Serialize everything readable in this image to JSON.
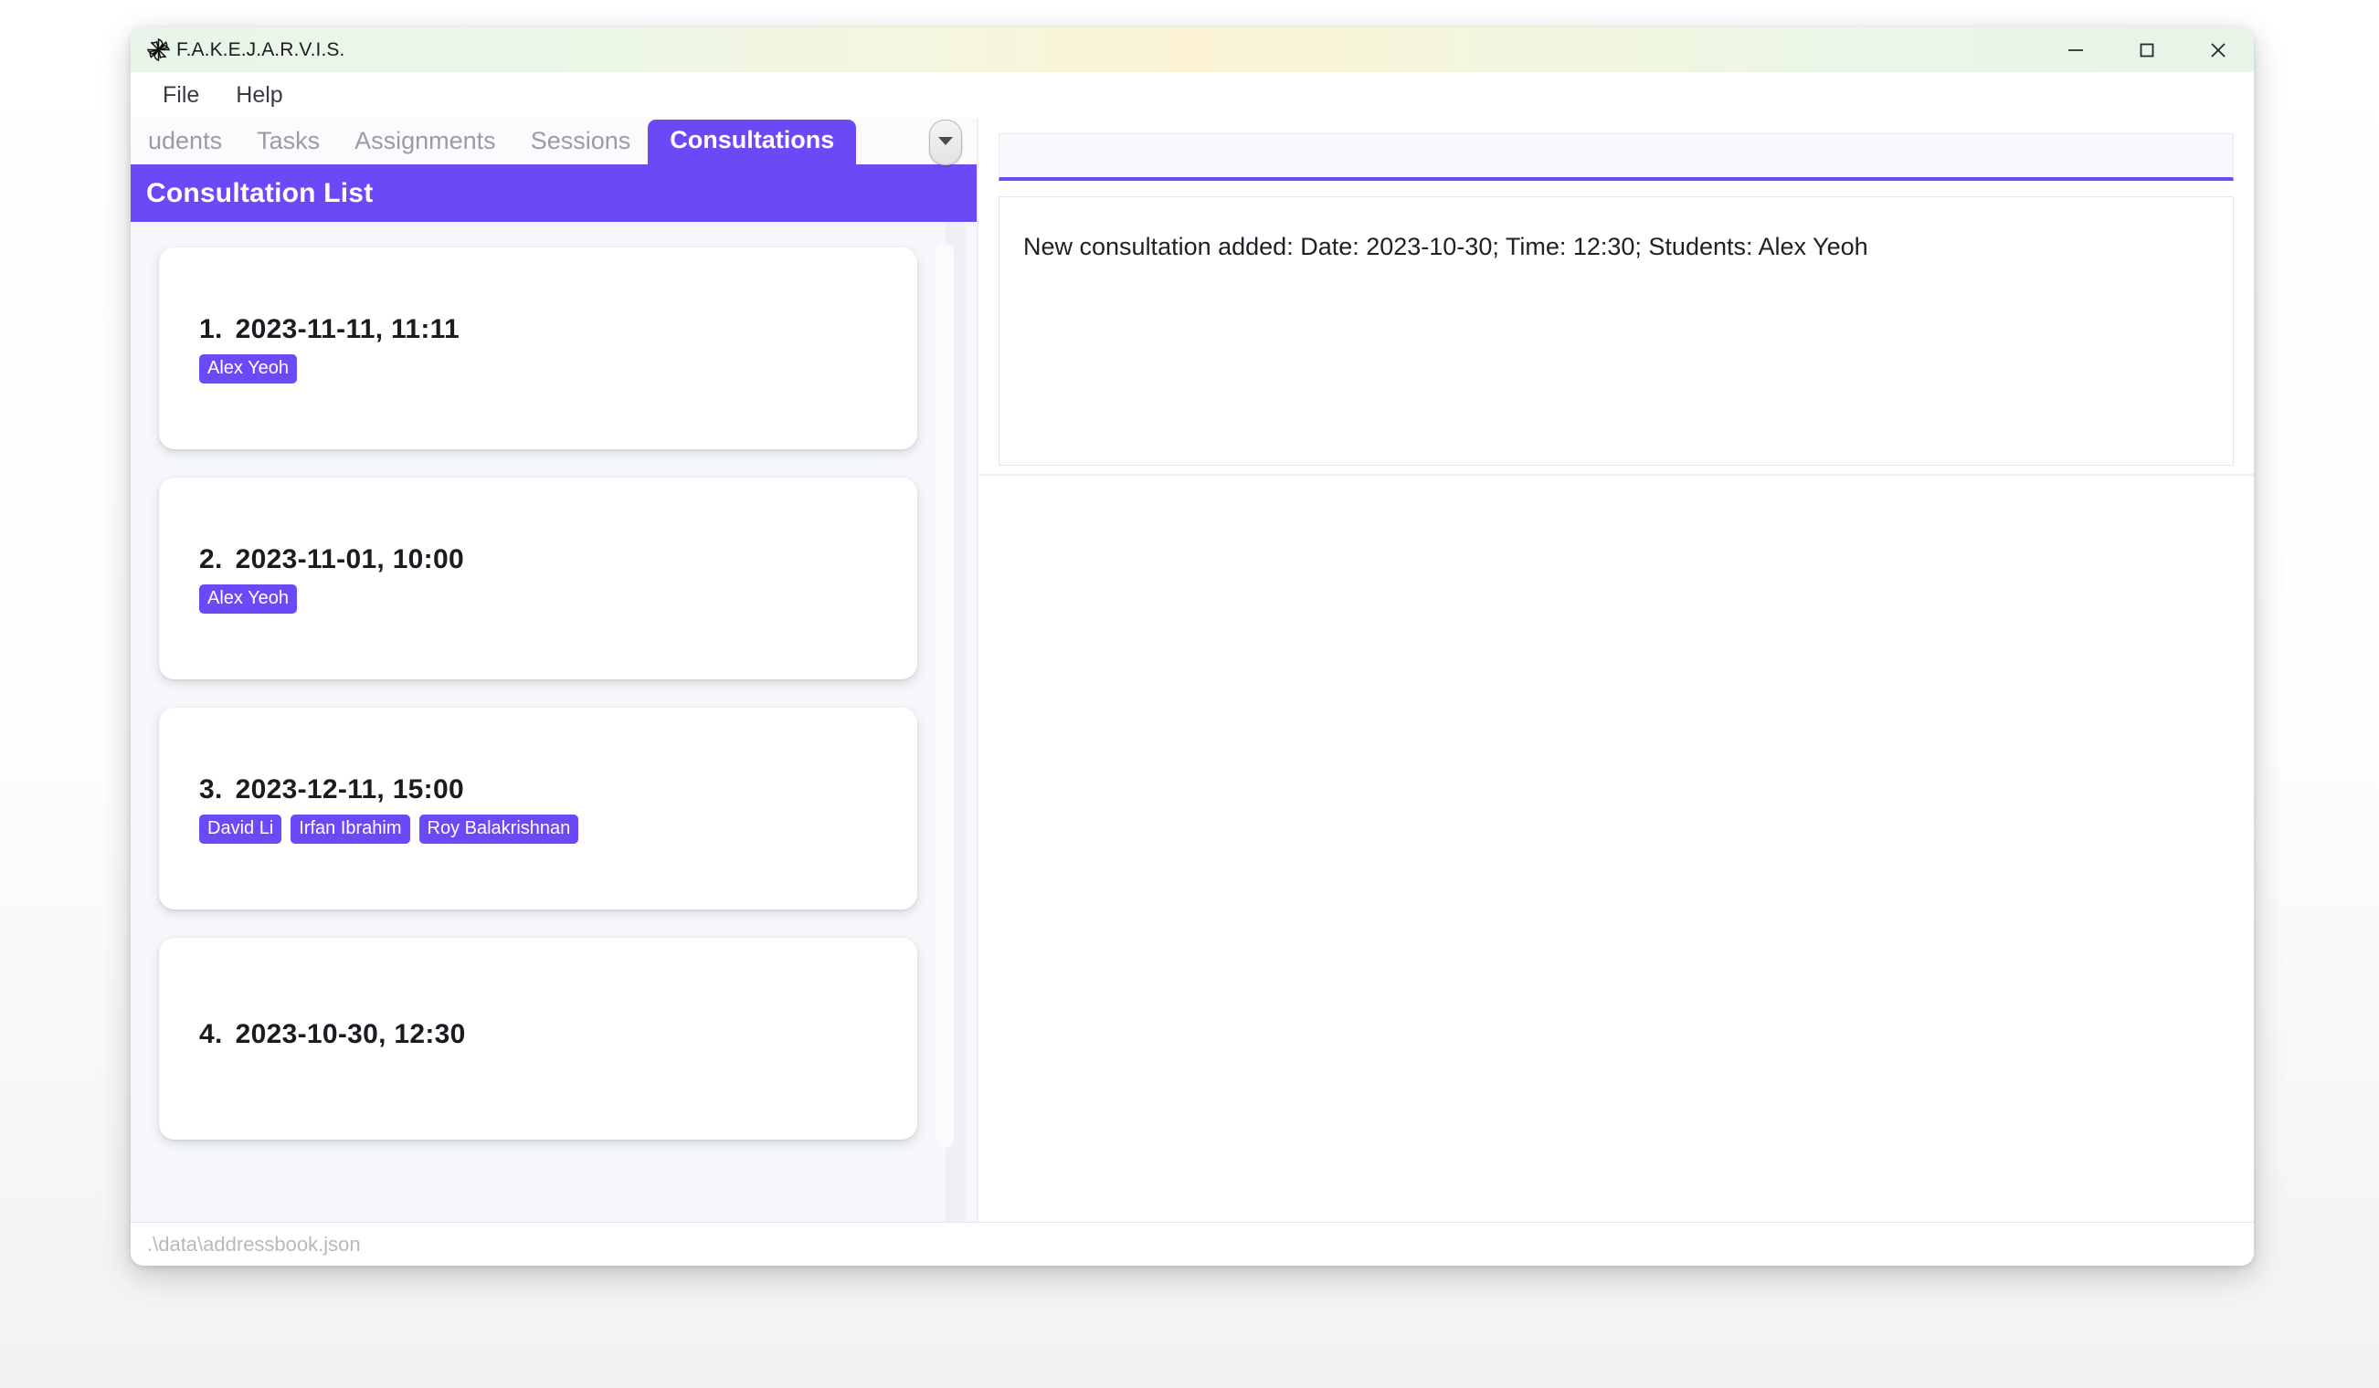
{
  "window": {
    "title": "F.A.K.E.J.A.R.V.I.S.",
    "app_icon": "pinwheel-icon",
    "controls": {
      "minimize": "minimize-icon",
      "maximize": "maximize-icon",
      "close": "close-icon"
    },
    "accent_color": "#6c49f7",
    "titlebar_gradient_colors": [
      "#e8f6e9",
      "#fbf3d4",
      "#e6f5e8"
    ]
  },
  "menu": {
    "items": [
      {
        "label": "File"
      },
      {
        "label": "Help"
      }
    ]
  },
  "tabs": {
    "items": [
      {
        "label": "udents",
        "active": false
      },
      {
        "label": "Tasks",
        "active": false
      },
      {
        "label": "Assignments",
        "active": false
      },
      {
        "label": "Sessions",
        "active": false
      },
      {
        "label": "Consultations",
        "active": true
      }
    ],
    "overflow_icon": "chevron-down-icon"
  },
  "list_panel": {
    "header_title": "Consultation List",
    "cards": [
      {
        "index": "1.",
        "datetime": "2023-11-11,  11:11",
        "students": [
          "Alex Yeoh"
        ]
      },
      {
        "index": "2.",
        "datetime": "2023-11-01,  10:00",
        "students": [
          "Alex Yeoh"
        ]
      },
      {
        "index": "3.",
        "datetime": "2023-12-11,  15:00",
        "students": [
          "David Li",
          "Irfan Ibrahim",
          "Roy Balakrishnan"
        ]
      },
      {
        "index": "4.",
        "datetime": "2023-10-30,  12:30",
        "students": []
      }
    ]
  },
  "command": {
    "value": "",
    "placeholder": ""
  },
  "result": {
    "message": "New consultation added: Date: 2023-10-30; Time: 12:30; Students: Alex Yeoh"
  },
  "status_bar": {
    "path": ".\\data\\addressbook.json"
  }
}
